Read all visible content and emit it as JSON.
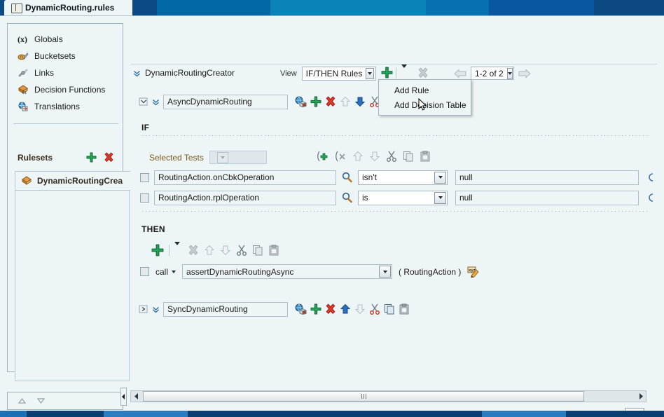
{
  "window": {
    "tab_title": "DynamicRouting.rules",
    "tab_icon": "rules-book-icon"
  },
  "sidebar": {
    "items": [
      {
        "label": "Globals",
        "icon": "globals-icon"
      },
      {
        "label": "Bucketsets",
        "icon": "bucketsets-icon"
      },
      {
        "label": "Links",
        "icon": "links-icon"
      },
      {
        "label": "Decision Functions",
        "icon": "decision-functions-icon"
      },
      {
        "label": "Translations",
        "icon": "translations-icon"
      }
    ],
    "rulesets_header": "Rulesets",
    "rulesets_add_tooltip": "Add",
    "rulesets_delete_tooltip": "Delete",
    "rulesets": [
      {
        "label": "DynamicRoutingCrea",
        "icon": "ruleset-icon",
        "selected": true
      }
    ]
  },
  "editor": {
    "ruleset_name": "DynamicRoutingCreator",
    "view_label": "View",
    "view_value": "IF/THEN Rules",
    "pager_value": "1-2 of 2",
    "add_menu": {
      "open": true,
      "items": [
        {
          "label": "Add Rule"
        },
        {
          "label": "Add Decision Table"
        }
      ]
    },
    "rules": [
      {
        "name": "AsyncDynamicRouting",
        "expanded": true,
        "if_label": "IF",
        "then_label": "THEN",
        "selected_tests_label": "Selected Tests",
        "selected_tests_value": "",
        "conditions": [
          {
            "checked": false,
            "left": "RoutingAction.onCbkOperation",
            "operator": "isn't",
            "right": "null"
          },
          {
            "checked": false,
            "left": "RoutingAction.rplOperation",
            "operator": "is",
            "right": "null"
          }
        ],
        "actions": [
          {
            "checked": false,
            "kind": "call",
            "target": "assertDynamicRoutingAsync",
            "argument": "( RoutingAction )"
          }
        ]
      },
      {
        "name": "SyncDynamicRouting",
        "expanded": false
      }
    ]
  },
  "colors": {
    "accent_blue": "#0a66a8",
    "panel_bg": "#eef5f6",
    "green_plus": "#199a4e",
    "red_x": "#cf2a1d",
    "label_brown": "#7a5c1e"
  }
}
